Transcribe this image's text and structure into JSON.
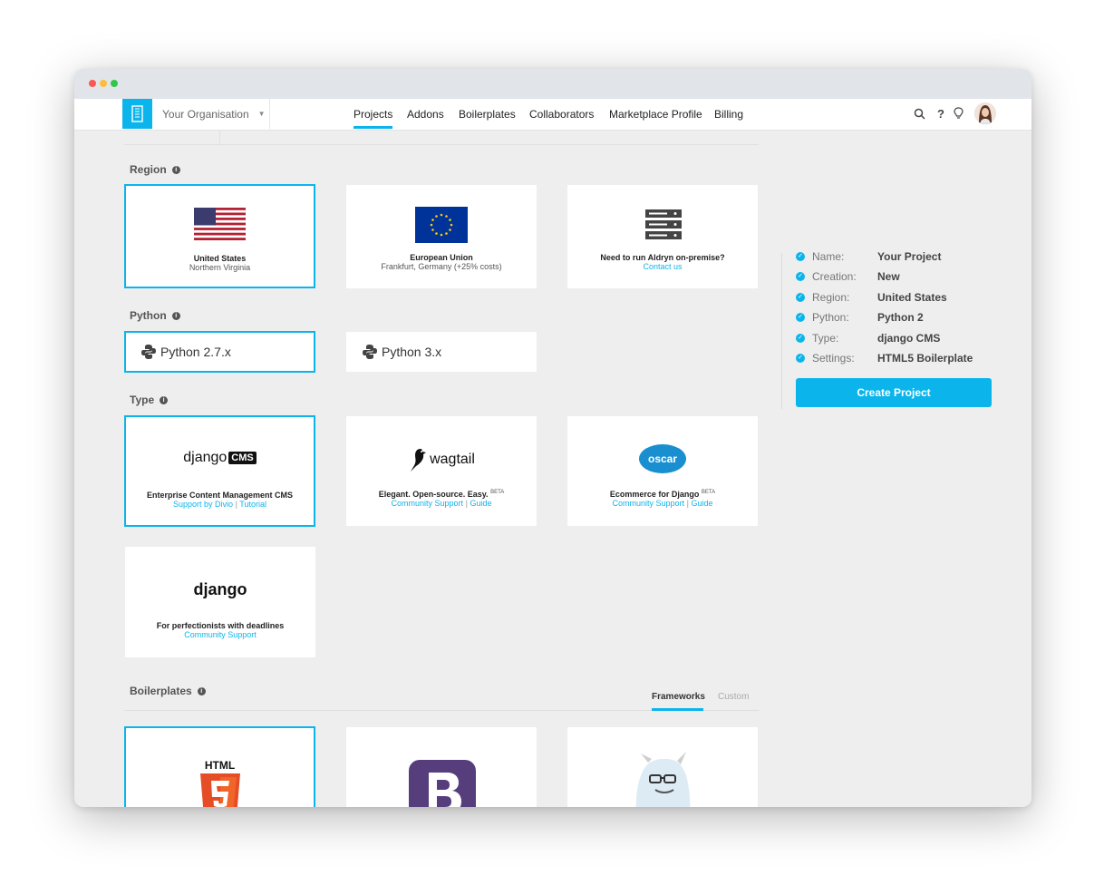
{
  "nav": {
    "org_name": "Your Organisation",
    "items": [
      "Projects",
      "Addons",
      "Boilerplates",
      "Collaborators",
      "Marketplace Profile",
      "Billing"
    ],
    "icons": [
      "search-icon",
      "help-icon",
      "lightbulb-icon"
    ]
  },
  "region": {
    "title": "Region",
    "cards": [
      {
        "title": "United States",
        "sub": "Northern Virginia"
      },
      {
        "title": "European Union",
        "sub": "Frankfurt, Germany (+25% costs)"
      },
      {
        "title": "Need to run Aldryn on-premise?",
        "link": "Contact us"
      }
    ]
  },
  "python": {
    "title": "Python",
    "options": [
      "Python 2.7.x",
      "Python 3.x"
    ]
  },
  "type": {
    "title": "Type",
    "cards": [
      {
        "logo_left": "django",
        "logo_right": "CMS",
        "title": "Enterprise Content Management CMS",
        "link1": "Support by Divio",
        "link2": "Tutorial"
      },
      {
        "logo": "wagtail",
        "title": "Elegant. Open-source. Easy.",
        "beta": "BETA",
        "link1": "Community Support",
        "link2": "Guide"
      },
      {
        "logo": "oscar",
        "title": "Ecommerce for Django",
        "beta": "BETA",
        "link1": "Community Support",
        "link2": "Guide"
      },
      {
        "logo": "django",
        "title": "For perfectionists with deadlines",
        "link1": "Community Support"
      }
    ]
  },
  "boilerplates": {
    "title": "Boilerplates",
    "tabs": [
      "Frameworks",
      "Custom"
    ],
    "html5_label": "HTML"
  },
  "summary": {
    "rows": [
      {
        "label": "Name:",
        "value": "Your Project"
      },
      {
        "label": "Creation:",
        "value": "New"
      },
      {
        "label": "Region:",
        "value": "United States"
      },
      {
        "label": "Python:",
        "value": "Python 2"
      },
      {
        "label": "Type:",
        "value": "django CMS"
      },
      {
        "label": "Settings:",
        "value": "HTML5 Boilerplate"
      }
    ],
    "button": "Create Project"
  },
  "colors": {
    "accent": "#0bb5ec",
    "background": "#eeeeee"
  }
}
